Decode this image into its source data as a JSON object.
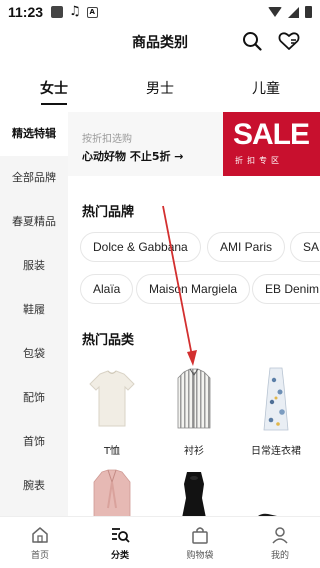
{
  "status_bar": {
    "time": "11:23",
    "icons": [
      "square-icon",
      "music-note-icon",
      "a-box-icon",
      "wifi-icon",
      "signal-icon",
      "battery-icon"
    ]
  },
  "header": {
    "title": "商品类别",
    "icons": [
      "search-icon",
      "heart-icon"
    ]
  },
  "gender_tabs": [
    {
      "label": "女士",
      "active": true
    },
    {
      "label": "男士",
      "active": false
    },
    {
      "label": "儿童",
      "active": false
    }
  ],
  "sidebar": {
    "items": [
      {
        "label": "精选特辑",
        "active": true
      },
      {
        "label": "全部品牌",
        "active": false
      },
      {
        "label": "春夏精品",
        "active": false
      },
      {
        "label": "服装",
        "active": false
      },
      {
        "label": "鞋履",
        "active": false
      },
      {
        "label": "包袋",
        "active": false
      },
      {
        "label": "配饰",
        "active": false
      },
      {
        "label": "首饰",
        "active": false
      },
      {
        "label": "腕表",
        "active": false
      }
    ]
  },
  "banner": {
    "subtitle": "按折扣选购",
    "title": "心动好物 不止5折 →",
    "sale_text": "SALE",
    "sale_sub": "折扣专区",
    "sale_color": "#c8102e"
  },
  "hot_brands": {
    "title": "热门品牌",
    "row1": [
      "Dolce & Gabbana",
      "AMI Paris",
      "SAI"
    ],
    "row2": [
      "Alaïa",
      "Maison Margiela",
      "EB Denim"
    ]
  },
  "hot_categories": {
    "title": "热门品类",
    "items": [
      {
        "label": "T恤"
      },
      {
        "label": "衬衫"
      },
      {
        "label": "日常连衣裙"
      }
    ]
  },
  "bottom_nav": [
    {
      "label": "首页",
      "icon": "home-icon",
      "active": false
    },
    {
      "label": "分类",
      "icon": "category-search-icon",
      "active": true
    },
    {
      "label": "购物袋",
      "icon": "shopping-bag-icon",
      "active": false
    },
    {
      "label": "我的",
      "icon": "user-icon",
      "active": false
    }
  ],
  "colors": {
    "accent": "#c8102e",
    "annotation_arrow": "#d32f2f",
    "sidebar_bg": "#f5f5f5"
  }
}
